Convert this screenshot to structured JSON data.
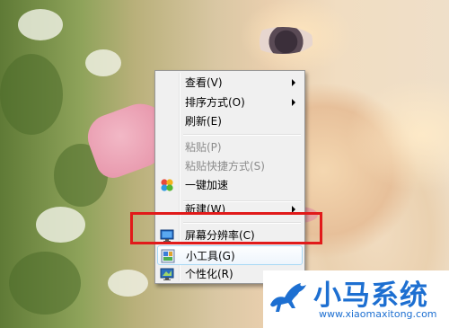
{
  "menu": {
    "items": [
      {
        "label": "查看(V)",
        "has_submenu": true,
        "disabled": false,
        "icon": "",
        "highlight": false
      },
      {
        "label": "排序方式(O)",
        "has_submenu": true,
        "disabled": false,
        "icon": "",
        "highlight": false
      },
      {
        "label": "刷新(E)",
        "has_submenu": false,
        "disabled": false,
        "icon": "",
        "highlight": false
      },
      {
        "label": "粘贴(P)",
        "has_submenu": false,
        "disabled": true,
        "icon": "",
        "highlight": false
      },
      {
        "label": "粘贴快捷方式(S)",
        "has_submenu": false,
        "disabled": true,
        "icon": "",
        "highlight": false
      },
      {
        "label": "一键加速",
        "has_submenu": false,
        "disabled": false,
        "icon": "speedup-icon",
        "highlight": false
      },
      {
        "label": "新建(W)",
        "has_submenu": true,
        "disabled": false,
        "icon": "",
        "highlight": false
      },
      {
        "label": "屏幕分辨率(C)",
        "has_submenu": false,
        "disabled": false,
        "icon": "screen-resolution-icon",
        "highlight": false
      },
      {
        "label": "小工具(G)",
        "has_submenu": false,
        "disabled": false,
        "icon": "gadgets-icon",
        "highlight": true
      },
      {
        "label": "个性化(R)",
        "has_submenu": false,
        "disabled": false,
        "icon": "personalize-icon",
        "highlight": false
      }
    ]
  },
  "annotation": {
    "color": "#e11a1a"
  },
  "watermark": {
    "title": "小马系统",
    "url": "www.xiaomaxitong.com",
    "color": "#1d6fd1",
    "icon": "horse-logo-icon"
  }
}
